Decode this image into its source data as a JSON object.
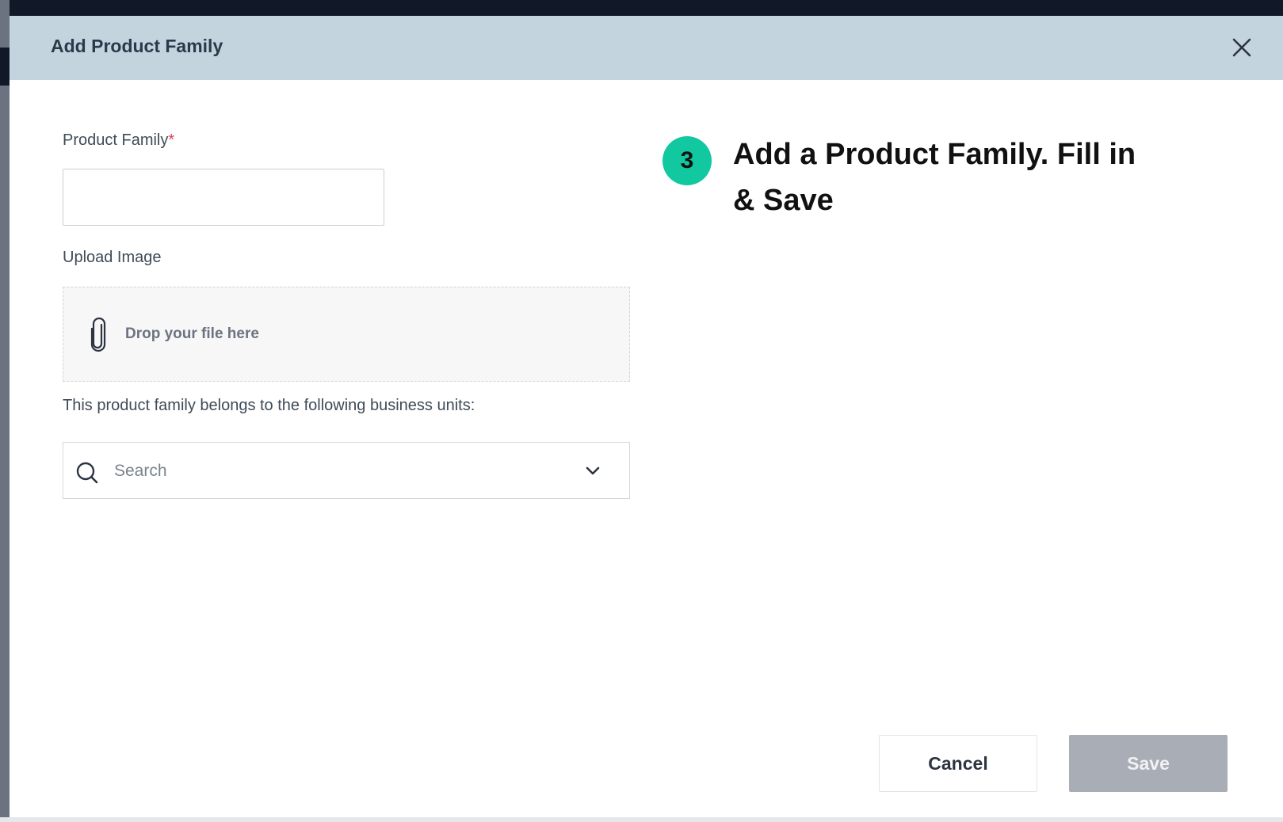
{
  "modal": {
    "title": "Add Product Family",
    "close_icon": "close-icon"
  },
  "form": {
    "product_family": {
      "label": "Product Family",
      "required_marker": "*",
      "value": "",
      "placeholder": ""
    },
    "upload_image": {
      "label": "Upload Image",
      "drop_text": "Drop your file here",
      "icon": "paperclip-icon"
    },
    "business_units": {
      "label": "This product family belongs to the following business units:",
      "search_placeholder": "Search",
      "search_icon": "search-icon",
      "dropdown_icon": "chevron-down-icon"
    }
  },
  "annotation": {
    "step_number": "3",
    "instruction": "Add a Product Family. Fill in & Save",
    "badge_color": "#12c8a0"
  },
  "footer": {
    "cancel_label": "Cancel",
    "save_label": "Save"
  },
  "colors": {
    "header_bg": "#c3d4df",
    "required": "#d9415b",
    "save_disabled": "#a9adb5"
  }
}
